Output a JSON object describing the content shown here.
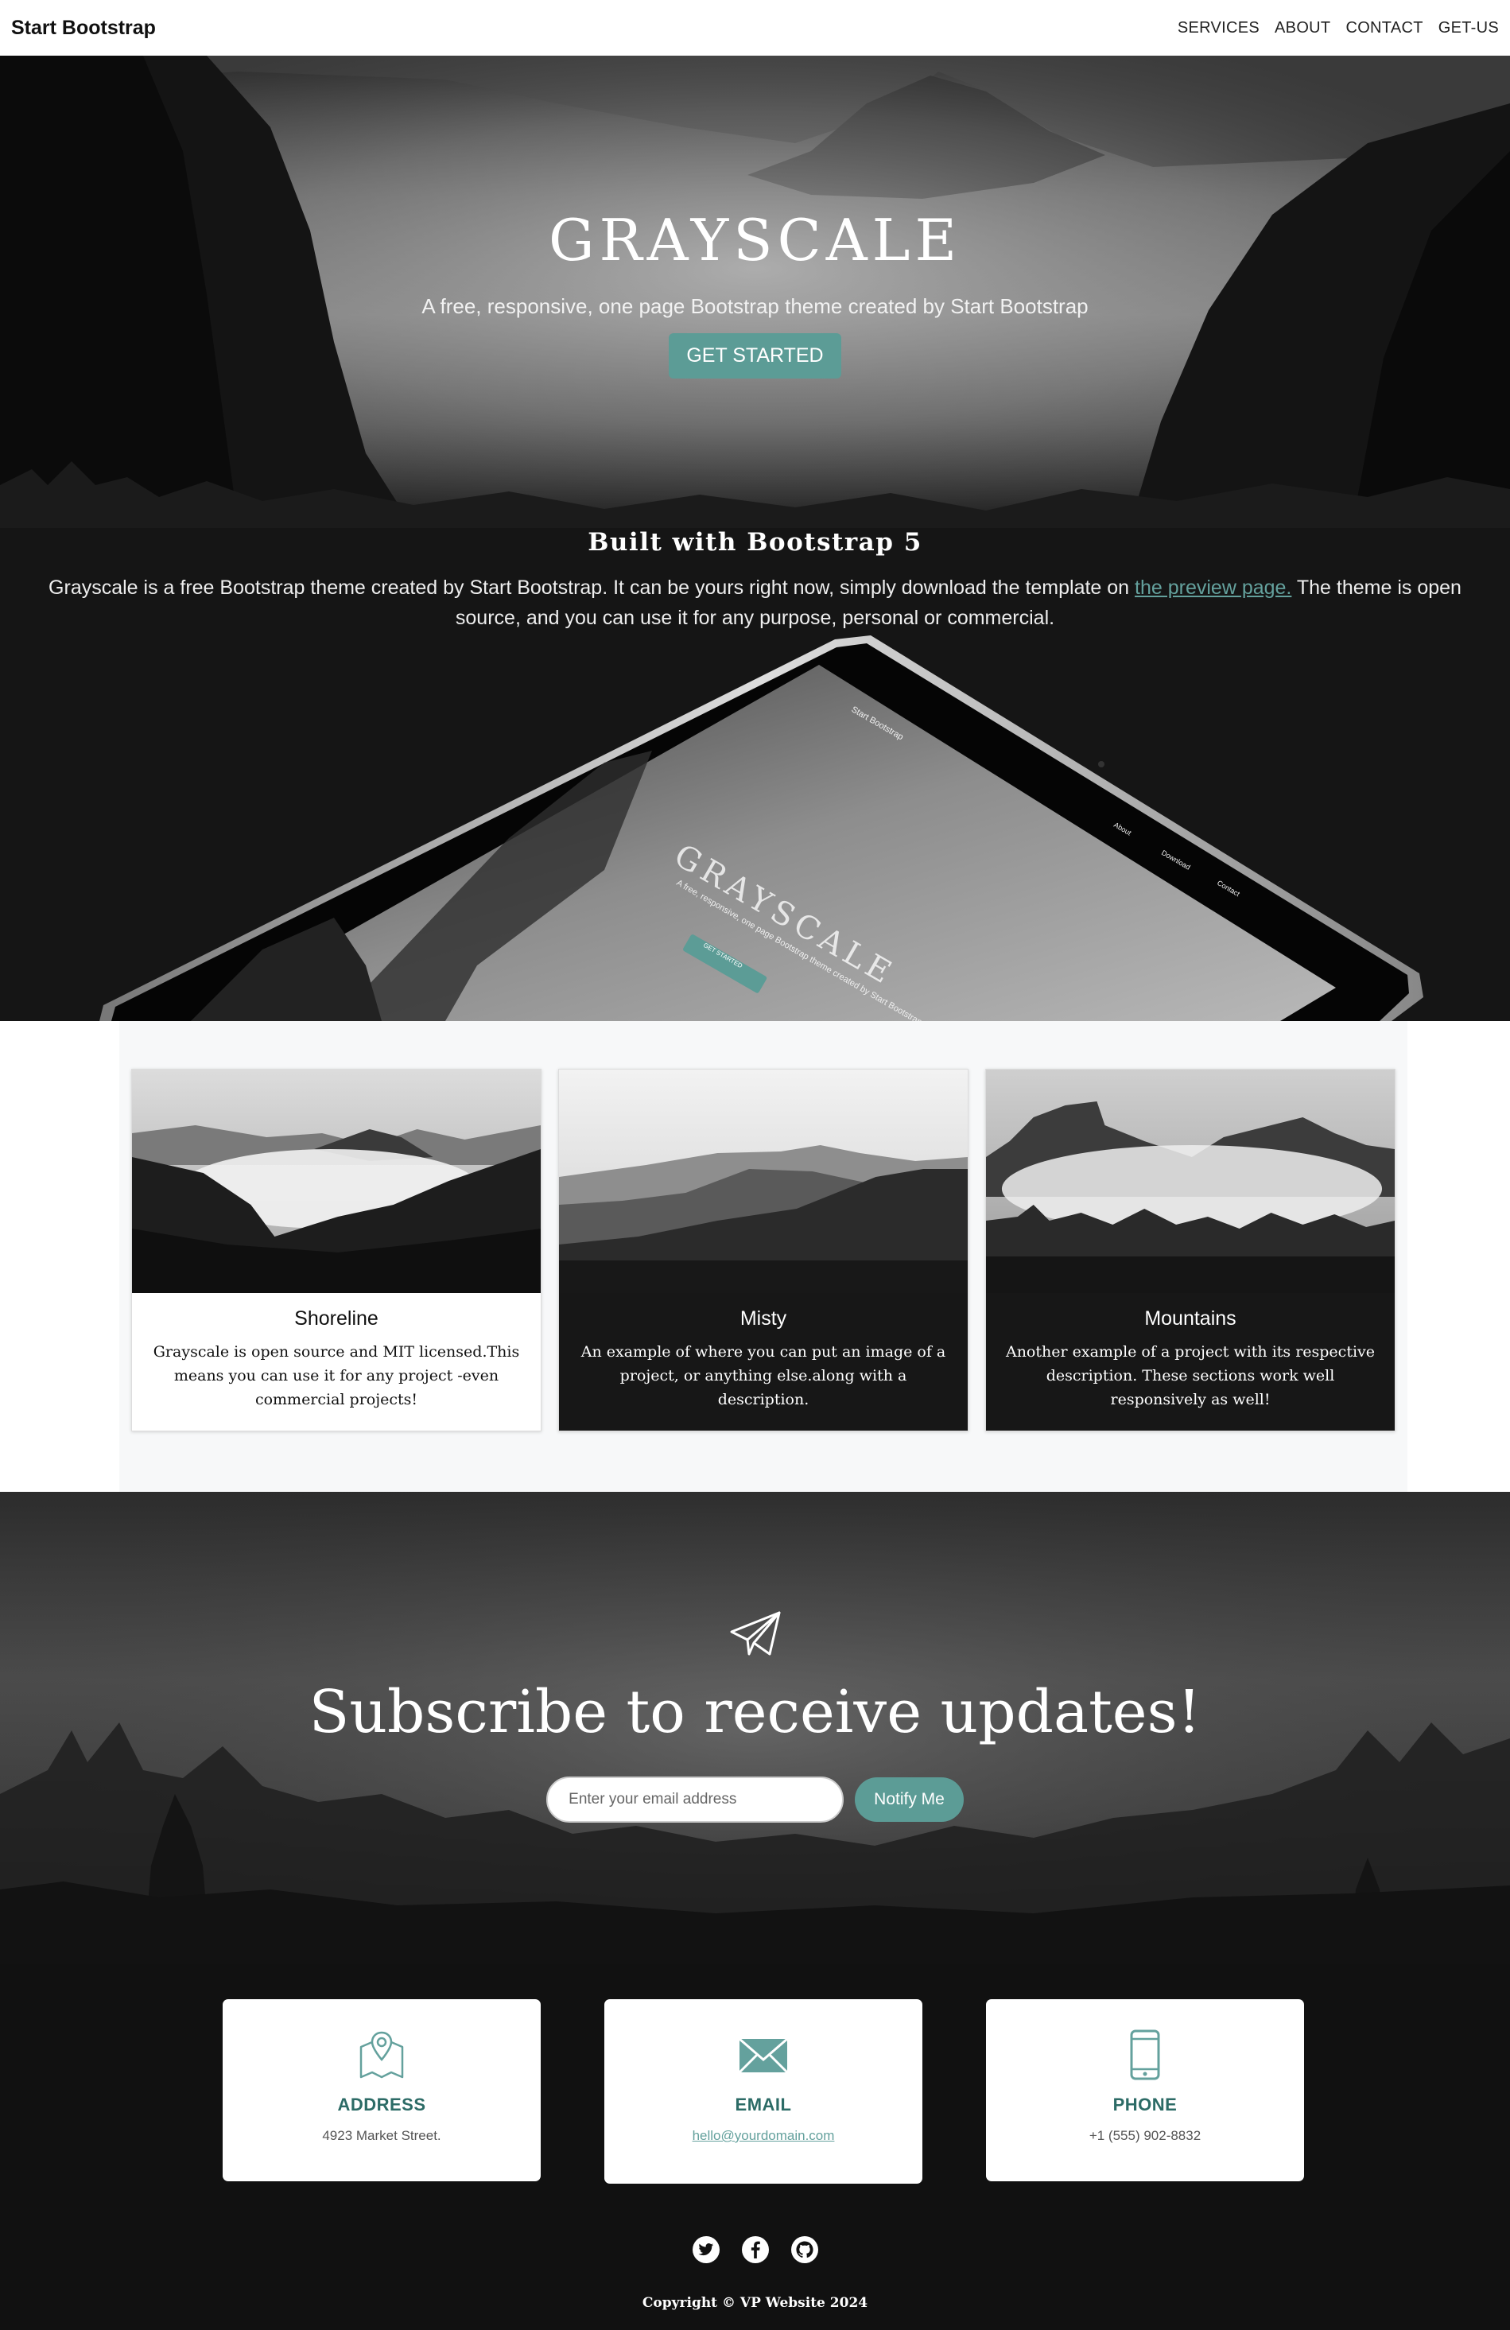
{
  "navbar": {
    "brand": "Start Bootstrap",
    "links": [
      "SERVICES",
      "ABOUT",
      "CONTACT",
      "GET-US"
    ]
  },
  "hero": {
    "title": "GRAYSCALE",
    "subtitle": "A free, responsive, one page Bootstrap theme created by Start Bootstrap",
    "button": "GET STARTED"
  },
  "about": {
    "title": "Built with Bootstrap 5",
    "text_before": "Grayscale is a free Bootstrap theme created by Start Bootstrap. It can be yours right now, simply download the template on ",
    "link": "the preview page.",
    "text_after": " The theme is open source, and you can use it for any purpose, personal or commercial.",
    "tablet": {
      "brand": "Start Bootstrap",
      "title": "GRAYSCALE",
      "subtitle": "A free, responsive, one page Bootstrap theme created by Start Bootstrap",
      "button": "GET STARTED",
      "links": [
        "About",
        "Download",
        "Contact"
      ]
    }
  },
  "projects": [
    {
      "title": "Shoreline",
      "text": "Grayscale is open source and MIT licensed.This means you can use it for any project -even commercial projects!",
      "theme": "light"
    },
    {
      "title": "Misty",
      "text": "An example of where you can put an image of a project, or anything else.along with a description.",
      "theme": "dark"
    },
    {
      "title": "Mountains",
      "text": "Another example of a project with its respective description. These sections work well responsively as well!",
      "theme": "dark"
    }
  ],
  "signup": {
    "icon": "paper-plane-icon",
    "title": "Subscribe to receive updates!",
    "placeholder": "Enter your email address",
    "button": "Notify Me"
  },
  "contact": [
    {
      "icon": "map-icon",
      "title": "ADDRESS",
      "value": "4923 Market Street."
    },
    {
      "icon": "envelope-icon",
      "title": "EMAIL",
      "value": "hello@yourdomain.com"
    },
    {
      "icon": "mobile-icon",
      "title": "PHONE",
      "value": "+1 (555) 902-8832"
    }
  ],
  "social": [
    "twitter-icon",
    "facebook-icon",
    "github-icon"
  ],
  "colors": {
    "accent": "#64a19d",
    "accent_dark": "#2c6b66",
    "dark_bg": "#111111"
  },
  "footer": {
    "copyright": "Copyright © VP Website 2024"
  }
}
